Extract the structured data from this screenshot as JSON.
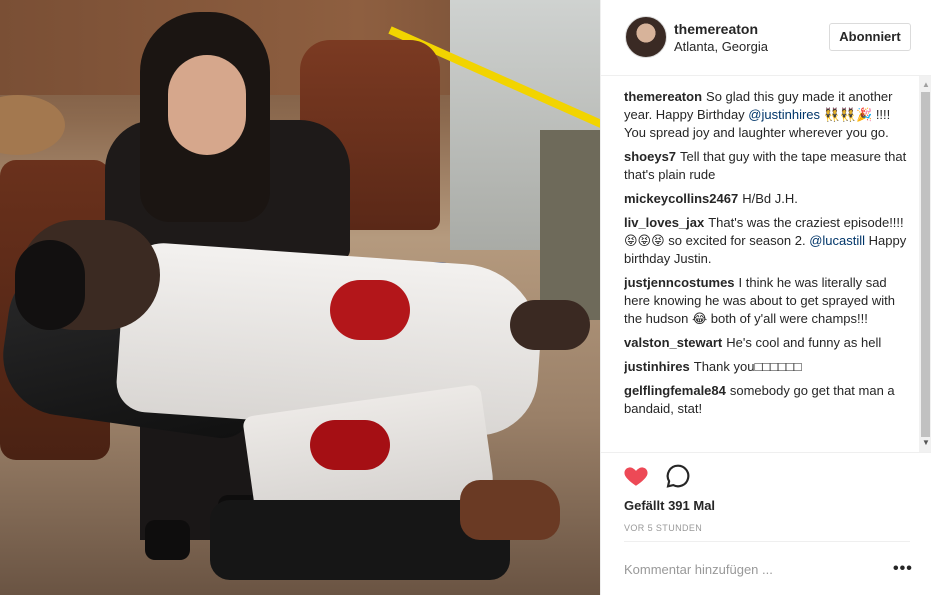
{
  "post": {
    "username": "themereaton",
    "location": "Atlanta, Georgia",
    "follow_label": "Abonniert"
  },
  "comments": [
    {
      "user": "themereaton",
      "text": "So glad this guy made it another year. Happy Birthday ",
      "mention": "@justinhires",
      "text2": " 👯👯🎉 !!!! You spread joy and laughter wherever you go."
    },
    {
      "user": "shoeys7",
      "text": "Tell that guy with the tape measure that that's plain rude"
    },
    {
      "user": "mickeycollins2467",
      "text": "H/Bd J.H."
    },
    {
      "user": "liv_loves_jax",
      "text": "That's was the craziest episode!!!!😝😝😝 so excited for season 2. ",
      "mention": "@lucastill",
      "text2": " Happy birthday Justin."
    },
    {
      "user": "justjenncostumes",
      "text": "I think he was literally sad here knowing he was about to get sprayed with the hudson 😂 both of y'all were champs!!!"
    },
    {
      "user": "valston_stewart",
      "text": "He's cool and funny as hell"
    },
    {
      "user": "justinhires",
      "text": "Thank you□□□□□□"
    },
    {
      "user": "gelflingfemale84",
      "text": "somebody go get that man a bandaid, stat!"
    }
  ],
  "actions": {
    "likes": "Gefällt 391 Mal",
    "time": "VOR 5 STUNDEN",
    "comment_placeholder": "Kommentar hinzufügen ...",
    "more": "•••"
  },
  "colors": {
    "heart": "#ed4956",
    "text": "#262626",
    "muted": "#999999",
    "border": "#efefef"
  }
}
